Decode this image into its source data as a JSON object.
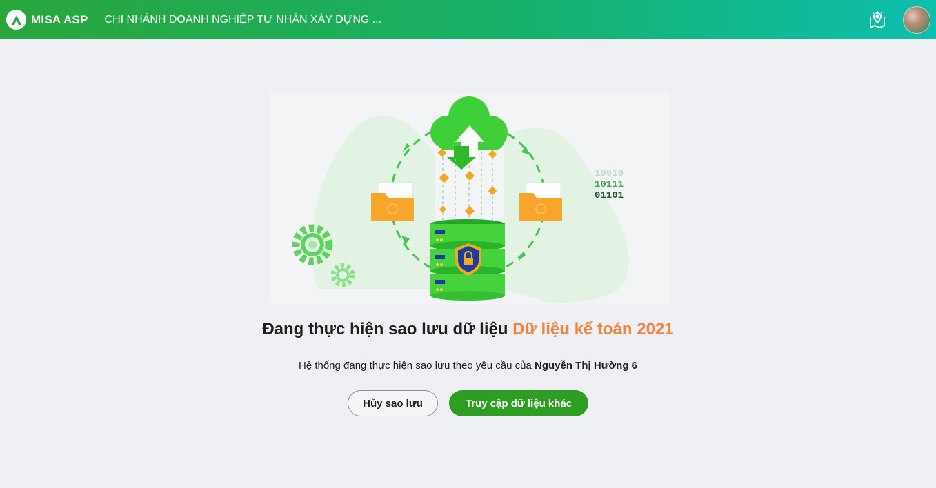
{
  "header": {
    "brand": "MISA ASP",
    "company_name": "CHI NHÁNH DOANH NGHIỆP TƯ NHÂN XÂY DỰNG ...",
    "icons": {
      "logo": "misa-logo-icon",
      "map": "map-pin-icon",
      "avatar": "user-avatar"
    }
  },
  "colors": {
    "header_start": "#2aa63c",
    "header_end": "#0dbfae",
    "highlight": "#f5823a",
    "primary_button": "#2e9e23",
    "page_background": "#eef0f4"
  },
  "illustration": {
    "binary_lines": [
      "10010",
      "10111",
      "01101"
    ]
  },
  "main": {
    "title_prefix": "Đang thực hiện sao lưu dữ liệu",
    "title_highlight": "Dữ liệu kế toán 2021",
    "subtitle_prefix": "Hệ thống đang thực hiện sao lưu theo yêu cầu của",
    "requester": "Nguyễn Thị Hường 6",
    "cancel_button": "Hủy sao lưu",
    "access_button": "Truy cập dữ liệu khác"
  }
}
